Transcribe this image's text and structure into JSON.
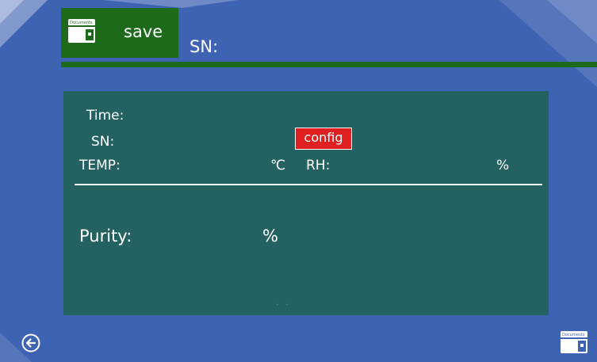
{
  "header": {
    "save_label": "save",
    "save_icon": "documents-icon",
    "save_icon_text": "Documents",
    "sn_label": "SN:"
  },
  "panel": {
    "time_label": "Time:",
    "sn_label": "SN:",
    "config_label": "config",
    "temp_label": "TEMP:",
    "temp_unit": "℃",
    "rh_label": "RH:",
    "rh_unit": "%",
    "purity_label": "Purity:",
    "purity_unit": "%",
    "dots": ". ."
  },
  "footer": {
    "back_icon": "back-arrow-icon",
    "corner_icon": "documents-icon",
    "corner_icon_text": "Documents"
  },
  "colors": {
    "background": "#3f63b3",
    "panel": "#246262",
    "save_button": "#1d6b1a",
    "config_button": "#e02020"
  }
}
